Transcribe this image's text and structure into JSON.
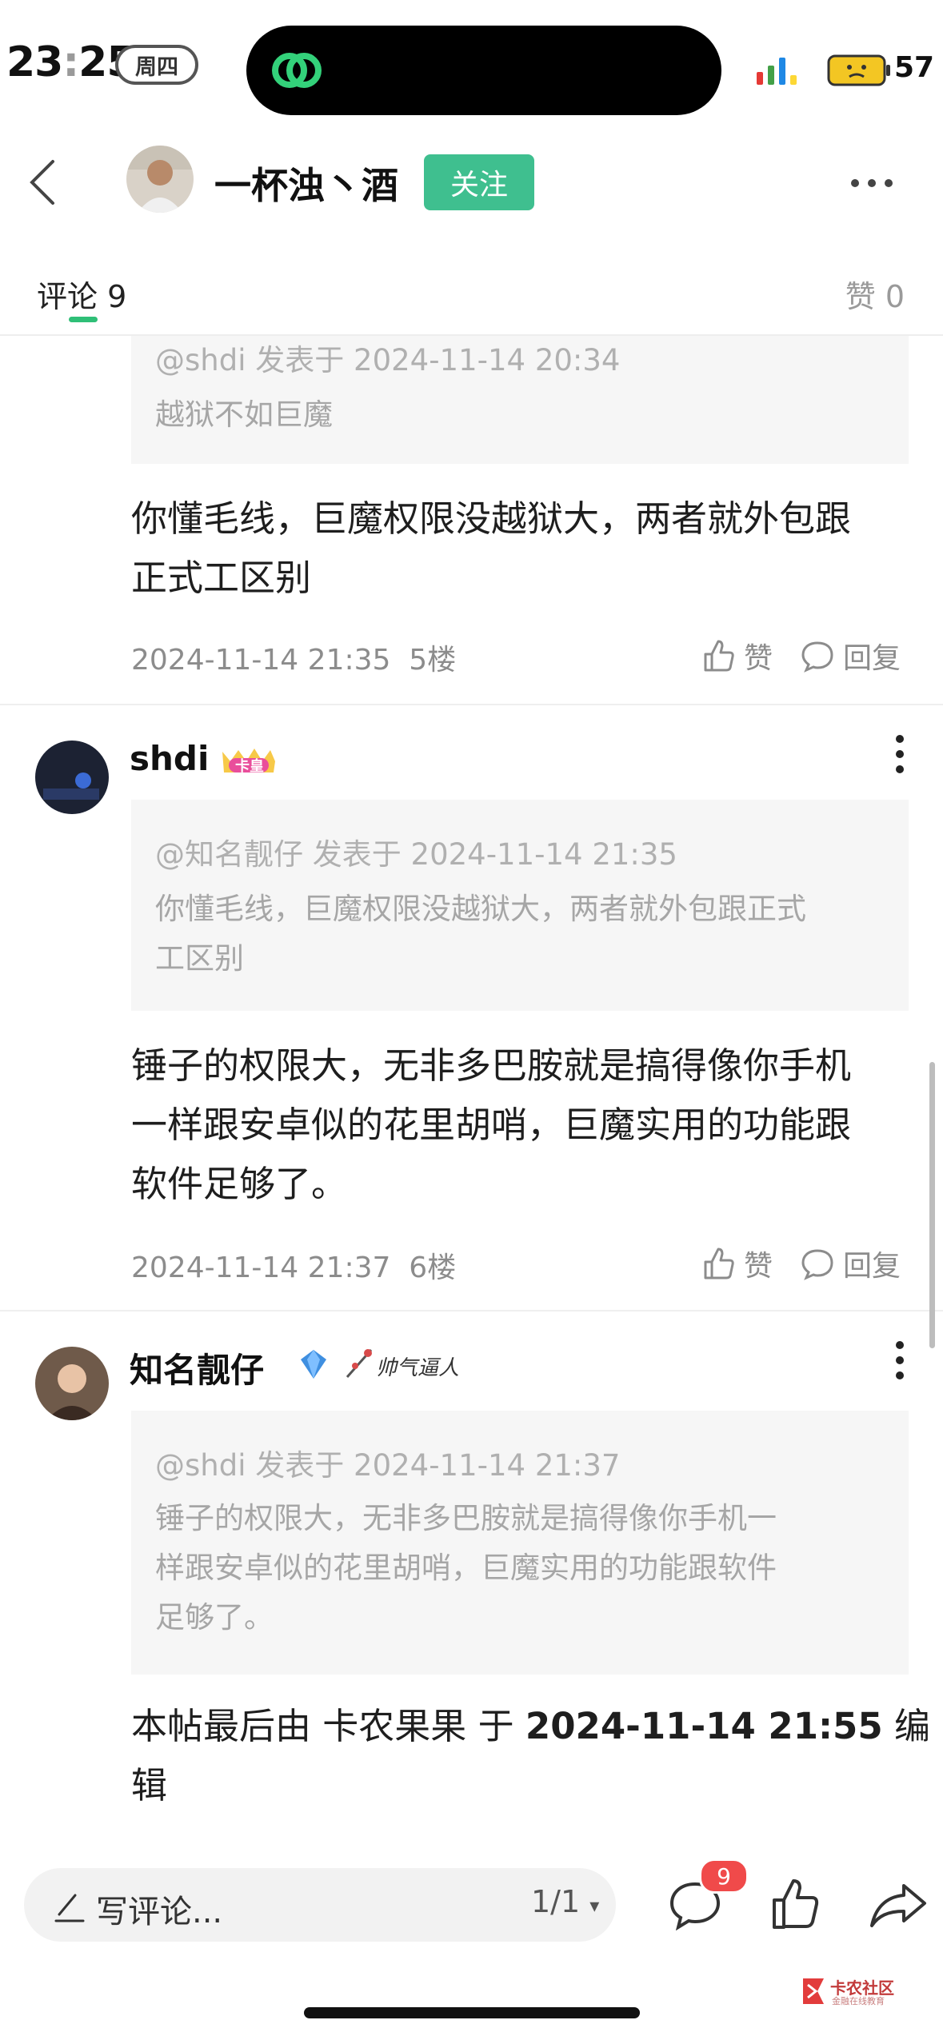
{
  "status_bar": {
    "time_hour": "23",
    "time_sep": ":",
    "time_min": "25",
    "day": "周四",
    "battery": "57"
  },
  "header": {
    "author": "一杯浊丶酒",
    "follow_label": "关注"
  },
  "tabs": {
    "comments_label": "评论",
    "comments_count": "9",
    "likes_label": "赞",
    "likes_count": "0"
  },
  "comments": [
    {
      "quote_user": "@shdi",
      "quote_posted": "发表于",
      "quote_time": "2024-11-14 20:34",
      "quote_text": "越狱不如巨魔",
      "body_line1": "你懂毛线，巨魔权限没越狱大，两者就外包跟",
      "body_line2": "正式工区别",
      "time": "2024-11-14 21:35",
      "floor": "5楼",
      "like_label": "赞",
      "reply_label": "回复"
    },
    {
      "user": "shdi",
      "badge": "卡皇",
      "quote_user": "@知名靓仔",
      "quote_posted": "发表于",
      "quote_time": "2024-11-14 21:35",
      "quote_line1": "你懂毛线，巨魔权限没越狱大，两者就外包跟正式",
      "quote_line2": "工区别",
      "body_line1": "锤子的权限大，无非多巴胺就是搞得像你手机",
      "body_line2": "一样跟安卓似的花里胡哨，巨魔实用的功能跟",
      "body_line3": "软件足够了。",
      "time": "2024-11-14 21:37",
      "floor": "6楼",
      "like_label": "赞",
      "reply_label": "回复"
    },
    {
      "user": "知名靓仔",
      "badge_text": "帅气逼人",
      "quote_user": "@shdi",
      "quote_posted": "发表于",
      "quote_time": "2024-11-14 21:37",
      "quote_line1": "锤子的权限大，无非多巴胺就是搞得像你手机一",
      "quote_line2": "样跟安卓似的花里胡哨，巨魔实用的功能跟软件",
      "quote_line3": "足够了。",
      "body_line1_pre": "本帖最后由 卡农果果 于 ",
      "body_line1_time": "2024-11-14 21:55",
      "body_line1_post": " 编",
      "body_line2": "辑"
    }
  ],
  "bottom_bar": {
    "input_placeholder": "写评论...",
    "page_indicator": "1/1",
    "comment_badge": "9"
  },
  "watermark": {
    "line1": "卡农社区",
    "line2": "金融在线教育"
  },
  "colors": {
    "accent": "#3fbf8f",
    "badge": "#f04a4a",
    "quote_bg": "#f6f6f6"
  }
}
